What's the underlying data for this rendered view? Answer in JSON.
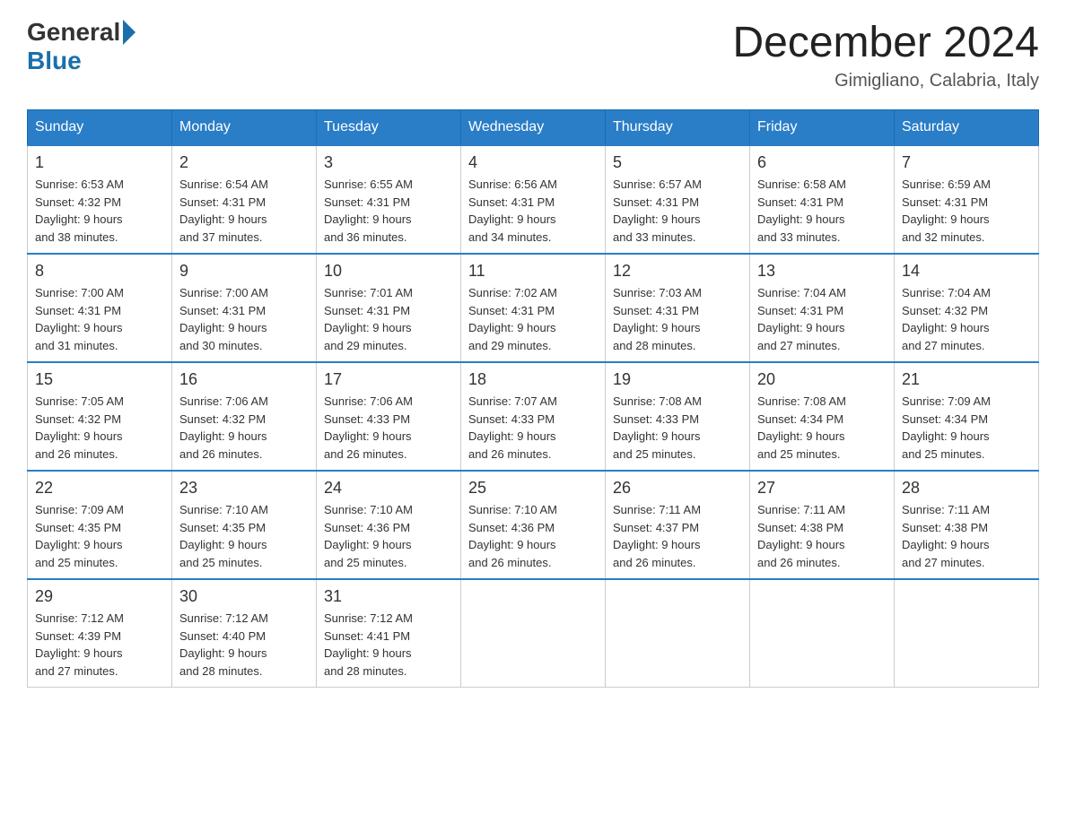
{
  "header": {
    "logo": {
      "general": "General",
      "blue": "Blue"
    },
    "title": "December 2024",
    "location": "Gimigliano, Calabria, Italy"
  },
  "days_of_week": [
    "Sunday",
    "Monday",
    "Tuesday",
    "Wednesday",
    "Thursday",
    "Friday",
    "Saturday"
  ],
  "weeks": [
    [
      {
        "day": "1",
        "sunrise": "6:53 AM",
        "sunset": "4:32 PM",
        "daylight": "9 hours and 38 minutes."
      },
      {
        "day": "2",
        "sunrise": "6:54 AM",
        "sunset": "4:31 PM",
        "daylight": "9 hours and 37 minutes."
      },
      {
        "day": "3",
        "sunrise": "6:55 AM",
        "sunset": "4:31 PM",
        "daylight": "9 hours and 36 minutes."
      },
      {
        "day": "4",
        "sunrise": "6:56 AM",
        "sunset": "4:31 PM",
        "daylight": "9 hours and 34 minutes."
      },
      {
        "day": "5",
        "sunrise": "6:57 AM",
        "sunset": "4:31 PM",
        "daylight": "9 hours and 33 minutes."
      },
      {
        "day": "6",
        "sunrise": "6:58 AM",
        "sunset": "4:31 PM",
        "daylight": "9 hours and 33 minutes."
      },
      {
        "day": "7",
        "sunrise": "6:59 AM",
        "sunset": "4:31 PM",
        "daylight": "9 hours and 32 minutes."
      }
    ],
    [
      {
        "day": "8",
        "sunrise": "7:00 AM",
        "sunset": "4:31 PM",
        "daylight": "9 hours and 31 minutes."
      },
      {
        "day": "9",
        "sunrise": "7:00 AM",
        "sunset": "4:31 PM",
        "daylight": "9 hours and 30 minutes."
      },
      {
        "day": "10",
        "sunrise": "7:01 AM",
        "sunset": "4:31 PM",
        "daylight": "9 hours and 29 minutes."
      },
      {
        "day": "11",
        "sunrise": "7:02 AM",
        "sunset": "4:31 PM",
        "daylight": "9 hours and 29 minutes."
      },
      {
        "day": "12",
        "sunrise": "7:03 AM",
        "sunset": "4:31 PM",
        "daylight": "9 hours and 28 minutes."
      },
      {
        "day": "13",
        "sunrise": "7:04 AM",
        "sunset": "4:31 PM",
        "daylight": "9 hours and 27 minutes."
      },
      {
        "day": "14",
        "sunrise": "7:04 AM",
        "sunset": "4:32 PM",
        "daylight": "9 hours and 27 minutes."
      }
    ],
    [
      {
        "day": "15",
        "sunrise": "7:05 AM",
        "sunset": "4:32 PM",
        "daylight": "9 hours and 26 minutes."
      },
      {
        "day": "16",
        "sunrise": "7:06 AM",
        "sunset": "4:32 PM",
        "daylight": "9 hours and 26 minutes."
      },
      {
        "day": "17",
        "sunrise": "7:06 AM",
        "sunset": "4:33 PM",
        "daylight": "9 hours and 26 minutes."
      },
      {
        "day": "18",
        "sunrise": "7:07 AM",
        "sunset": "4:33 PM",
        "daylight": "9 hours and 26 minutes."
      },
      {
        "day": "19",
        "sunrise": "7:08 AM",
        "sunset": "4:33 PM",
        "daylight": "9 hours and 25 minutes."
      },
      {
        "day": "20",
        "sunrise": "7:08 AM",
        "sunset": "4:34 PM",
        "daylight": "9 hours and 25 minutes."
      },
      {
        "day": "21",
        "sunrise": "7:09 AM",
        "sunset": "4:34 PM",
        "daylight": "9 hours and 25 minutes."
      }
    ],
    [
      {
        "day": "22",
        "sunrise": "7:09 AM",
        "sunset": "4:35 PM",
        "daylight": "9 hours and 25 minutes."
      },
      {
        "day": "23",
        "sunrise": "7:10 AM",
        "sunset": "4:35 PM",
        "daylight": "9 hours and 25 minutes."
      },
      {
        "day": "24",
        "sunrise": "7:10 AM",
        "sunset": "4:36 PM",
        "daylight": "9 hours and 25 minutes."
      },
      {
        "day": "25",
        "sunrise": "7:10 AM",
        "sunset": "4:36 PM",
        "daylight": "9 hours and 26 minutes."
      },
      {
        "day": "26",
        "sunrise": "7:11 AM",
        "sunset": "4:37 PM",
        "daylight": "9 hours and 26 minutes."
      },
      {
        "day": "27",
        "sunrise": "7:11 AM",
        "sunset": "4:38 PM",
        "daylight": "9 hours and 26 minutes."
      },
      {
        "day": "28",
        "sunrise": "7:11 AM",
        "sunset": "4:38 PM",
        "daylight": "9 hours and 27 minutes."
      }
    ],
    [
      {
        "day": "29",
        "sunrise": "7:12 AM",
        "sunset": "4:39 PM",
        "daylight": "9 hours and 27 minutes."
      },
      {
        "day": "30",
        "sunrise": "7:12 AM",
        "sunset": "4:40 PM",
        "daylight": "9 hours and 28 minutes."
      },
      {
        "day": "31",
        "sunrise": "7:12 AM",
        "sunset": "4:41 PM",
        "daylight": "9 hours and 28 minutes."
      },
      null,
      null,
      null,
      null
    ]
  ],
  "labels": {
    "sunrise": "Sunrise:",
    "sunset": "Sunset:",
    "daylight": "Daylight:"
  }
}
